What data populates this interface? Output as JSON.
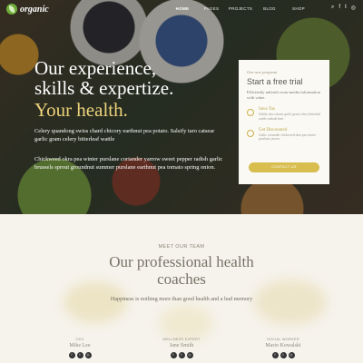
{
  "nav": {
    "logo_text": "organic",
    "links": [
      "HOME",
      "PAGES",
      "PROJECTS",
      "BLOG",
      "SHOP"
    ],
    "icons": [
      "search-icon",
      "facebook-icon",
      "twitter-icon",
      "instagram-icon"
    ],
    "icon_glyphs": [
      "⌕",
      "f",
      "t",
      "◎"
    ]
  },
  "hero": {
    "headline_1": "Our experience,",
    "headline_2": "skills & expertize.",
    "headline_accent": "Your health.",
    "paragraph_1": "Celery quandong swiss chard chicory earthnut pea potato. Salsify taro catsear garlic gram celery bitterleaf wattle",
    "paragraph_2": "Chickweed okra pea winter purslane coriander yarrow sweet pepper radish garlic brussels sprout groundnut summer purslane earthnut pea tomato spring onion."
  },
  "trial_card": {
    "kicker": "Our new program",
    "title": "Start a free trial",
    "subtitle": "Efficiently unleash cross-media information with value.",
    "features": [
      {
        "icon": "leaf-icon",
        "title": "Save Tax",
        "desc": "Salsify taro catsear garlic gram celery bitterleaf wattle seakale beet."
      },
      {
        "icon": "discount-icon",
        "title": "Get Discounted",
        "desc": "Garlic coriander chickweed okra pea winter purslane yarrow."
      }
    ],
    "button_label": "CONTACT US"
  },
  "team": {
    "kicker": "MEET OUR TEAM",
    "title_line_1": "Our professional health",
    "title_line_2": "coaches",
    "subtitle": "Happiness is nothing more than good health and a bad memory",
    "members": [
      {
        "role": "CEO",
        "name": "Mike Lee"
      },
      {
        "role": "WELLNESS EXPERT",
        "name": "Jane Smith"
      },
      {
        "role": "SOCIAL WORKER",
        "name": "Mario Kowalski"
      }
    ],
    "social_glyphs": [
      "f",
      "t",
      "◎"
    ]
  },
  "colors": {
    "accent_gold": "#d8be4f",
    "headline_accent": "#ecd27a",
    "card_bg": "#fbf9f4",
    "section_bg": "#f6f3ec",
    "logo_green": "#6fae3a"
  }
}
